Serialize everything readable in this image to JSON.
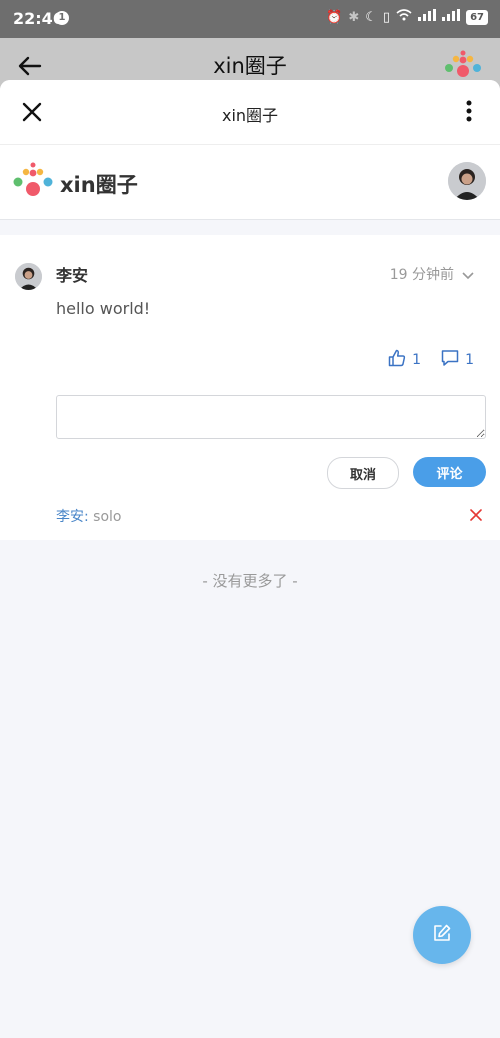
{
  "status_bar": {
    "time": "22:46",
    "notification_count": "1",
    "battery": "67"
  },
  "background_page": {
    "title": "xin圈子"
  },
  "navbar": {
    "title": "xin圈子"
  },
  "brand": {
    "name": "xin圈子"
  },
  "post": {
    "author": "李安",
    "time": "19 分钟前",
    "content": "hello world!",
    "like_count": "1",
    "comment_count": "1",
    "input_value": "",
    "cancel_label": "取消",
    "submit_label": "评论",
    "comment": {
      "author": "李安:",
      "text": "solo"
    }
  },
  "footer": {
    "no_more": "- 没有更多了 -"
  },
  "colors": {
    "accent": "#4a9ee8",
    "link": "#4a86c8",
    "fab": "#67b6ec",
    "delete": "#e53935"
  }
}
